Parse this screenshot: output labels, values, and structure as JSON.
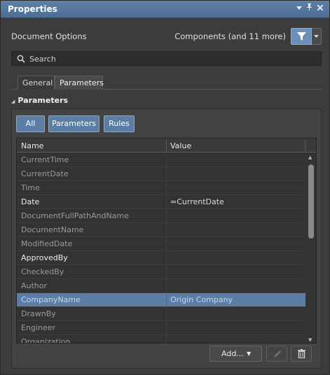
{
  "window": {
    "title": "Properties",
    "controls": [
      "dropdown-icon",
      "pin-icon",
      "close-icon"
    ]
  },
  "header": {
    "left_label": "Document Options",
    "right_label": "Components (and 11 more)"
  },
  "search": {
    "placeholder": "Search",
    "value": ""
  },
  "tabs": [
    {
      "label": "General",
      "active": false
    },
    {
      "label": "Parameters",
      "active": true
    }
  ],
  "section": {
    "title": "Parameters",
    "expanded": true
  },
  "filter_buttons": [
    {
      "label": "All"
    },
    {
      "label": "Parameters"
    },
    {
      "label": "Rules"
    }
  ],
  "table": {
    "columns": [
      "Name",
      "Value"
    ],
    "rows": [
      {
        "name": "CurrentTime",
        "value": "",
        "style": "dim"
      },
      {
        "name": "CurrentDate",
        "value": "",
        "style": "dim"
      },
      {
        "name": "Time",
        "value": "",
        "style": "dim"
      },
      {
        "name": "Date",
        "value": "=CurrentDate",
        "style": "bright"
      },
      {
        "name": "DocumentFullPathAndName",
        "value": "",
        "style": "dim"
      },
      {
        "name": "DocumentName",
        "value": "",
        "style": "dim"
      },
      {
        "name": "ModifiedDate",
        "value": "",
        "style": "dim"
      },
      {
        "name": "ApprovedBy",
        "value": "",
        "style": "bright"
      },
      {
        "name": "CheckedBy",
        "value": "",
        "style": "dim"
      },
      {
        "name": "Author",
        "value": "",
        "style": "dim"
      },
      {
        "name": "CompanyName",
        "value": "Origin Company",
        "style": "selected"
      },
      {
        "name": "DrawnBy",
        "value": "",
        "style": "dim"
      },
      {
        "name": "Engineer",
        "value": "",
        "style": "dim"
      },
      {
        "name": "Organization",
        "value": "",
        "style": "dim"
      }
    ]
  },
  "footer": {
    "add_label": "Add...",
    "icons": [
      "pencil-icon",
      "trash-icon"
    ]
  },
  "colors": {
    "titlebar": "#5574a0",
    "accent_button": "#5d7ea4",
    "selected_row": "#5c7da6",
    "background": "#3c3c3c"
  }
}
